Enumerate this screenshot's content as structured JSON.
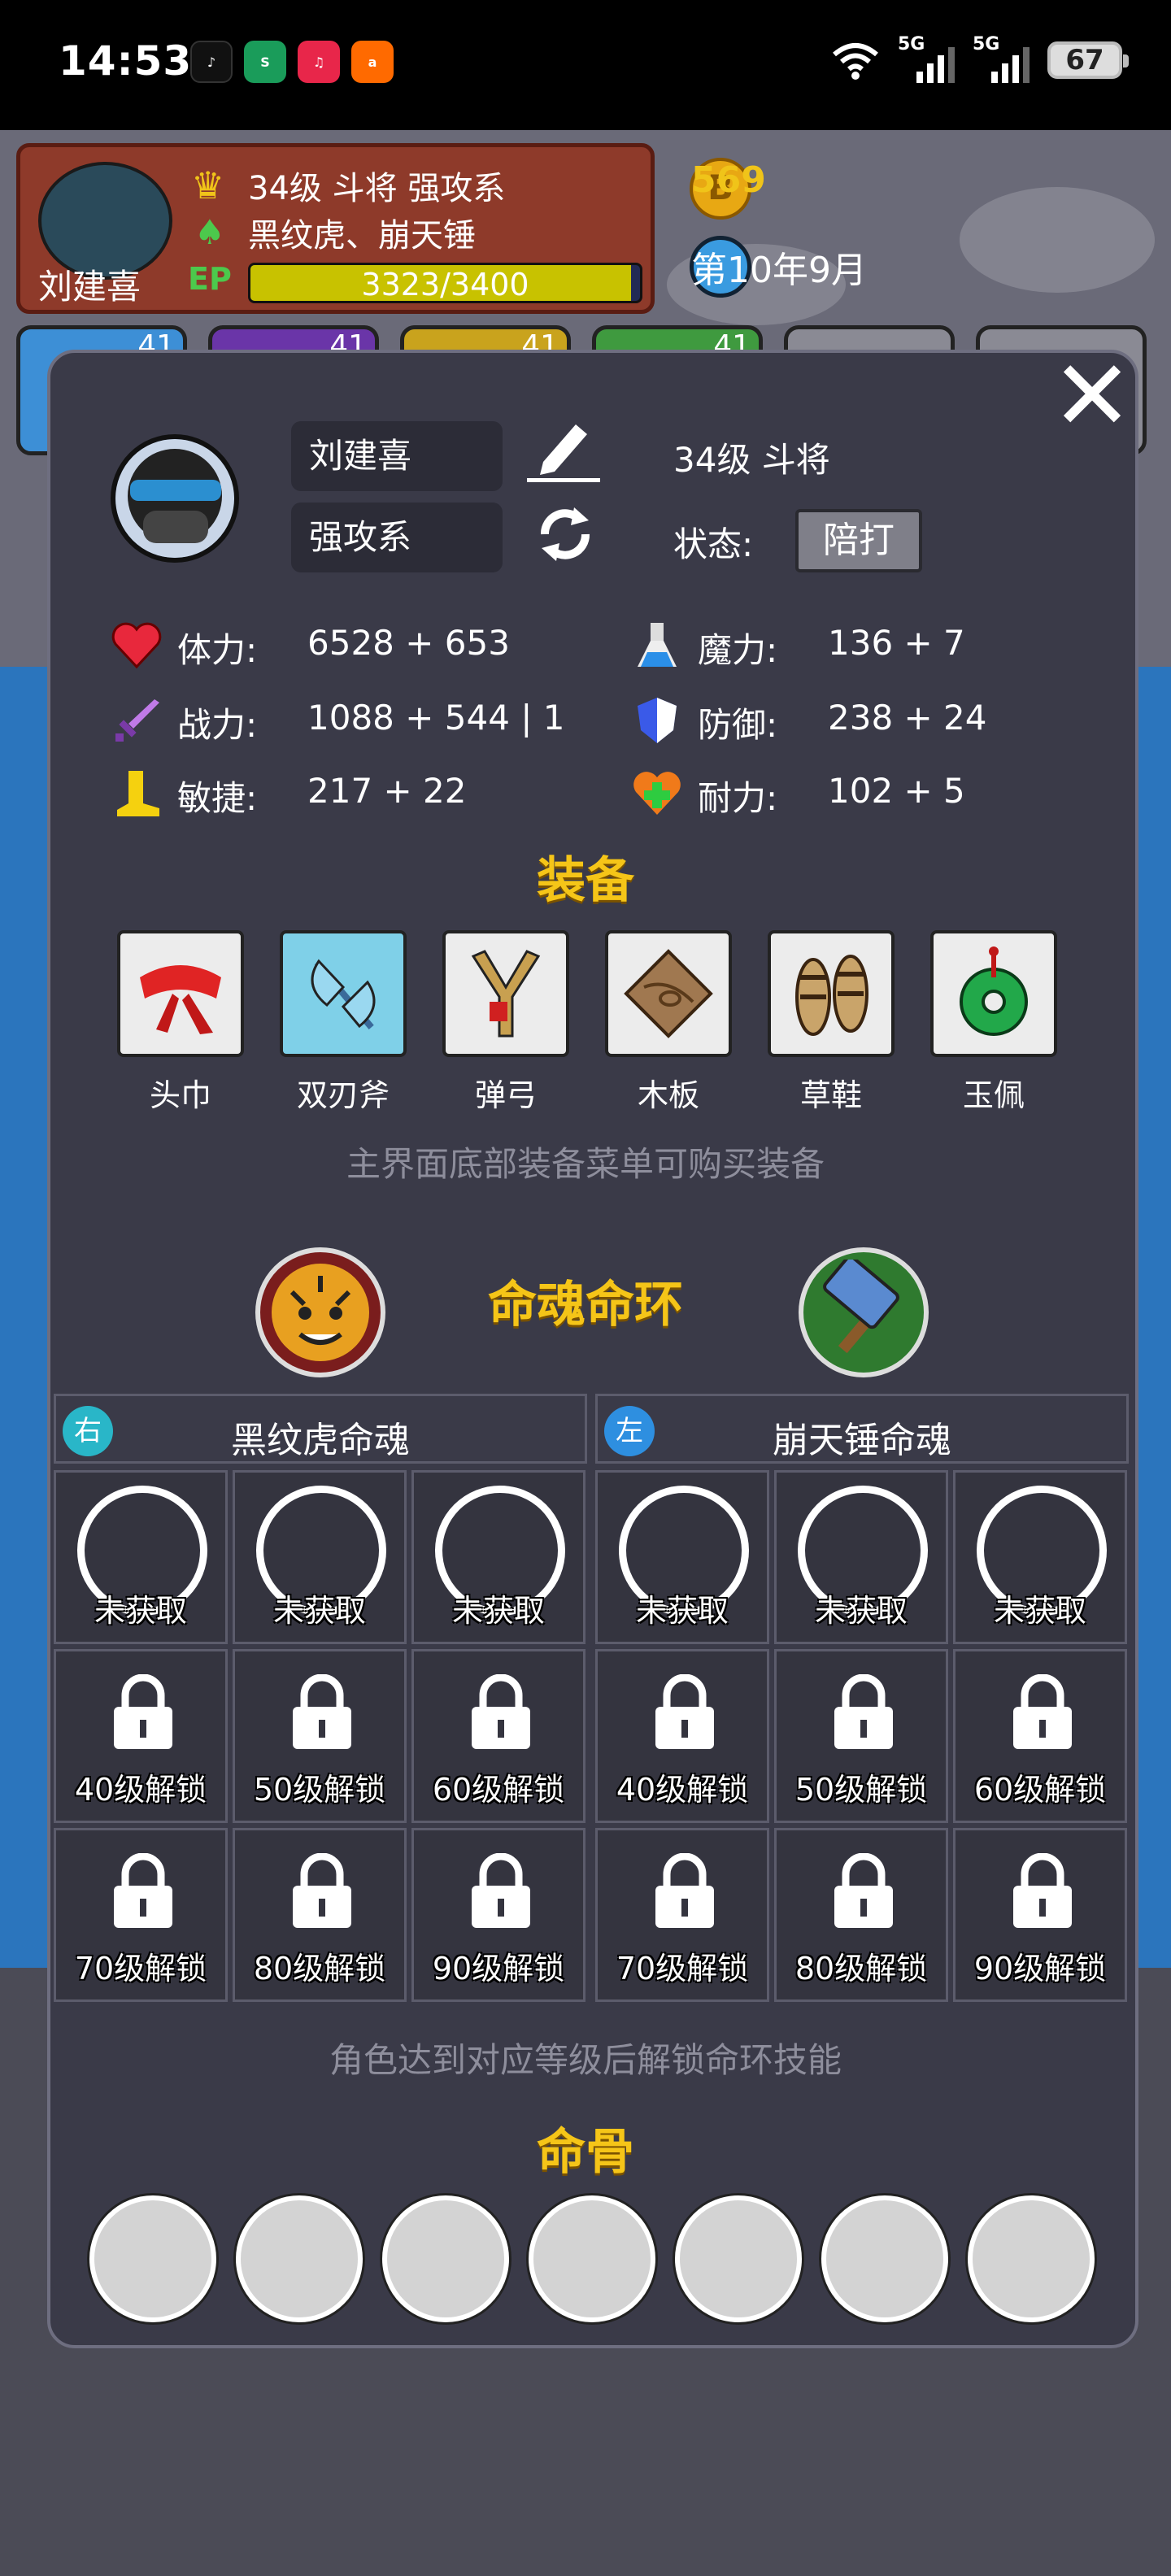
{
  "status_bar": {
    "time": "14:53",
    "apps": [
      "tiktok-icon",
      "sogou-icon",
      "douyin-icon",
      "1688-icon"
    ],
    "network_labels": [
      "5G",
      "5G"
    ],
    "battery": "67"
  },
  "game_hud": {
    "hero_name": "刘建喜",
    "hero_line1": "34级 斗将 强攻系",
    "hero_line2": "黑纹虎、崩天锤",
    "xp_text": "3323/3400",
    "xp_fraction": 0.977,
    "coins": "569",
    "date": "第10年9月",
    "team_levels": [
      "41",
      "41",
      "41",
      "41"
    ]
  },
  "profile": {
    "name": "刘建喜",
    "school": "强攻系",
    "level_title": "34级 斗将",
    "state_label": "状态:",
    "state_value": "陪打"
  },
  "stats": [
    {
      "label": "体力:",
      "value": "6528 + 653",
      "icon": "heart-icon"
    },
    {
      "label": "魔力:",
      "value": "136 + 7",
      "icon": "potion-icon"
    },
    {
      "label": "战力:",
      "value": "1088 + 544 | 1",
      "icon": "sword-icon"
    },
    {
      "label": "防御:",
      "value": "238 + 24",
      "icon": "shield-icon"
    },
    {
      "label": "敏捷:",
      "value": "217 + 22",
      "icon": "boot-icon"
    },
    {
      "label": "耐力:",
      "value": "102 + 5",
      "icon": "heart-plus-icon"
    }
  ],
  "equipment": {
    "title": "装备",
    "items": [
      {
        "label": "头巾",
        "icon": "headband-icon"
      },
      {
        "label": "双刃斧",
        "icon": "double-axe-icon"
      },
      {
        "label": "弹弓",
        "icon": "slingshot-icon"
      },
      {
        "label": "木板",
        "icon": "wood-plank-icon"
      },
      {
        "label": "草鞋",
        "icon": "sandals-icon"
      },
      {
        "label": "玉佩",
        "icon": "jade-pendant-icon"
      }
    ],
    "hint": "主界面底部装备菜单可购买装备"
  },
  "soul_rings": {
    "title": "命魂命环",
    "left_soul_icon": "tiger-icon",
    "right_soul_icon": "hammer-icon",
    "trees": [
      {
        "badge": "右",
        "badge_color": "#29b6c8",
        "title": "黑纹虎命魂",
        "row1": [
          "未获取",
          "未获取",
          "未获取"
        ],
        "row2": [
          "40级解锁",
          "50级解锁",
          "60级解锁"
        ],
        "row3": [
          "70级解锁",
          "80级解锁",
          "90级解锁"
        ]
      },
      {
        "badge": "左",
        "badge_color": "#2e8fe0",
        "title": "崩天锤命魂",
        "row1": [
          "未获取",
          "未获取",
          "未获取"
        ],
        "row2": [
          "40级解锁",
          "50级解锁",
          "60级解锁"
        ],
        "row3": [
          "70级解锁",
          "80级解锁",
          "90级解锁"
        ]
      }
    ],
    "hint": "角色达到对应等级后解锁命环技能"
  },
  "bones": {
    "title": "命骨",
    "slots": 7
  }
}
